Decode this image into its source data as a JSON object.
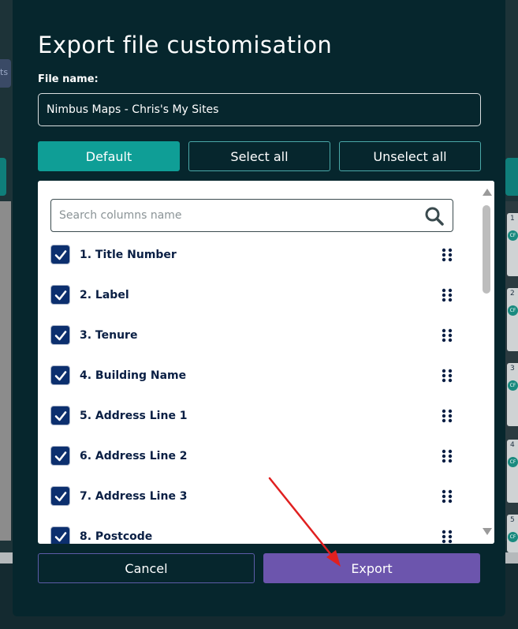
{
  "background": {
    "left_tab_label": "ts",
    "right_cards": [
      {
        "num": "1",
        "badge": "CF"
      },
      {
        "num": "2",
        "badge": "CF"
      },
      {
        "num": "3",
        "badge": "CF"
      },
      {
        "num": "4",
        "badge": "CF"
      },
      {
        "num": "5",
        "badge": "CF"
      }
    ]
  },
  "modal": {
    "title": "Export file customisation",
    "file_name_label": "File name:",
    "file_name_value": "Nimbus Maps - Chris's My Sites",
    "buttons": {
      "default": "Default",
      "select_all": "Select all",
      "unselect_all": "Unselect all"
    },
    "search": {
      "placeholder": "Search columns name"
    },
    "columns": [
      {
        "label": "1. Title Number",
        "checked": true
      },
      {
        "label": "2. Label",
        "checked": true
      },
      {
        "label": "3. Tenure",
        "checked": true
      },
      {
        "label": "4. Building Name",
        "checked": true
      },
      {
        "label": "5. Address Line 1",
        "checked": true
      },
      {
        "label": "6. Address Line 2",
        "checked": true
      },
      {
        "label": "7. Address Line 3",
        "checked": true
      },
      {
        "label": "8. Postcode",
        "checked": true
      }
    ],
    "footer": {
      "cancel": "Cancel",
      "export": "Export"
    }
  },
  "colors": {
    "modal_bg": "#06262d",
    "accent_teal": "#0f9e96",
    "export_purple": "#6c55ad",
    "checkbox_blue": "#0c2f6e",
    "annotation_red": "#e02020"
  }
}
